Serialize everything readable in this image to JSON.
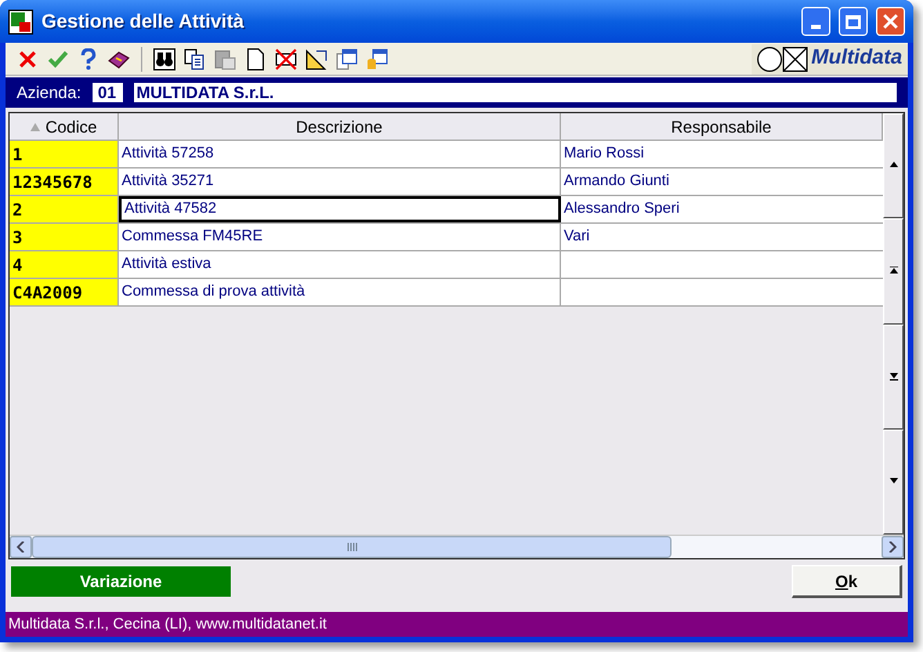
{
  "window": {
    "title": "Gestione delle Attività"
  },
  "toolbar": {
    "logo_text": "Multidata"
  },
  "azienda": {
    "label": "Azienda:",
    "code": "01",
    "name": "MULTIDATA S.r.L."
  },
  "table": {
    "columns": [
      {
        "label": "Codice",
        "sorted": true
      },
      {
        "label": "Descrizione",
        "sorted": false
      },
      {
        "label": "Responsabile",
        "sorted": false
      }
    ],
    "rows": [
      {
        "code": "1",
        "description": "Attività 57258",
        "owner": "Mario Rossi",
        "selected": false
      },
      {
        "code": "12345678",
        "description": "Attività 35271",
        "owner": "Armando Giunti",
        "selected": false
      },
      {
        "code": "2",
        "description": "Attività 47582",
        "owner": "Alessandro Speri",
        "selected": true
      },
      {
        "code": "3",
        "description": "Commessa FM45RE",
        "owner": "Vari",
        "selected": false
      },
      {
        "code": "4",
        "description": "Attività estiva",
        "selected": false
      },
      {
        "code": "C4A2009",
        "description": "Commessa di prova attività",
        "selected": false
      }
    ]
  },
  "mode_label": "Variazione",
  "ok_button": "Ok",
  "status_bar": "Multidata S.r.l., Cecina (LI), www.multidatanet.it"
}
